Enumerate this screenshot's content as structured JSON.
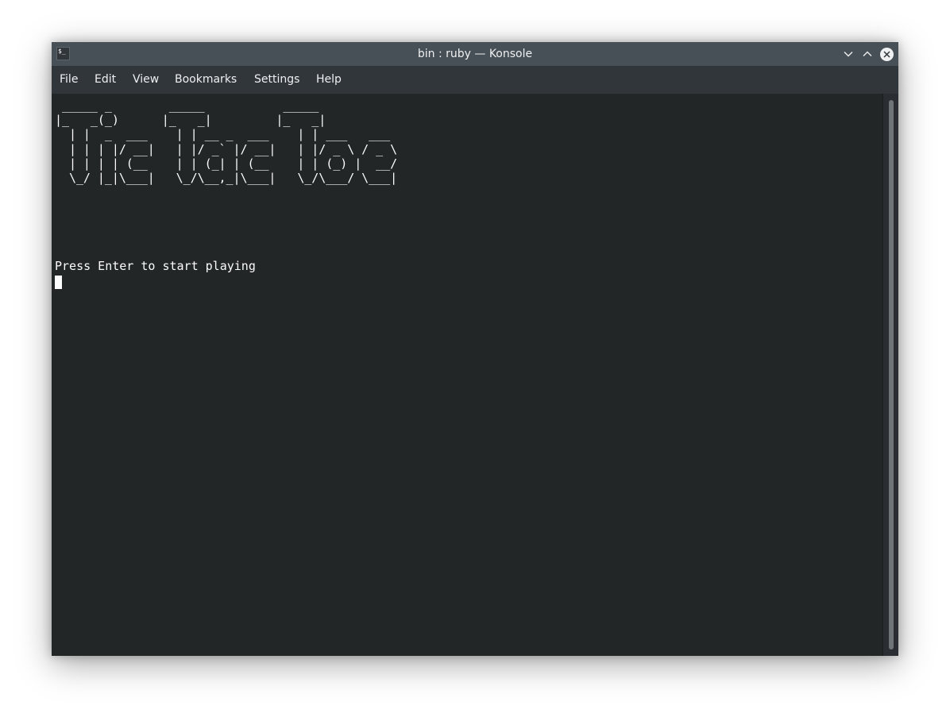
{
  "window": {
    "title": "bin : ruby — Konsole",
    "app_icon_glyph": "$_",
    "buttons": [
      "minimize",
      "maximize",
      "close"
    ]
  },
  "menubar": {
    "items": [
      "File",
      "Edit",
      "View",
      "Bookmarks",
      "Settings",
      "Help"
    ]
  },
  "terminal": {
    "ascii_art": " _____ _        _____           _____\n|_   _(_)      |_   _|         |_   _|\n  | |  _  ___    | | __ _  ___    | | ___   ___\n  | | | |/ __|   | |/ _` |/ __|   | |/ _ \\ / _ \\\n  | | | | (__    | | (_| | (__    | | (_) |  __/\n  \\_/ |_|\\___|   \\_/\\__,_|\\___|   \\_/\\___/ \\___|",
    "prompt": "Press Enter to start playing"
  },
  "colors": {
    "terminal_bg": "#232627",
    "terminal_fg": "#fcfcfc",
    "titlebar_bg": "#475057",
    "menubar_bg": "#31363b"
  }
}
